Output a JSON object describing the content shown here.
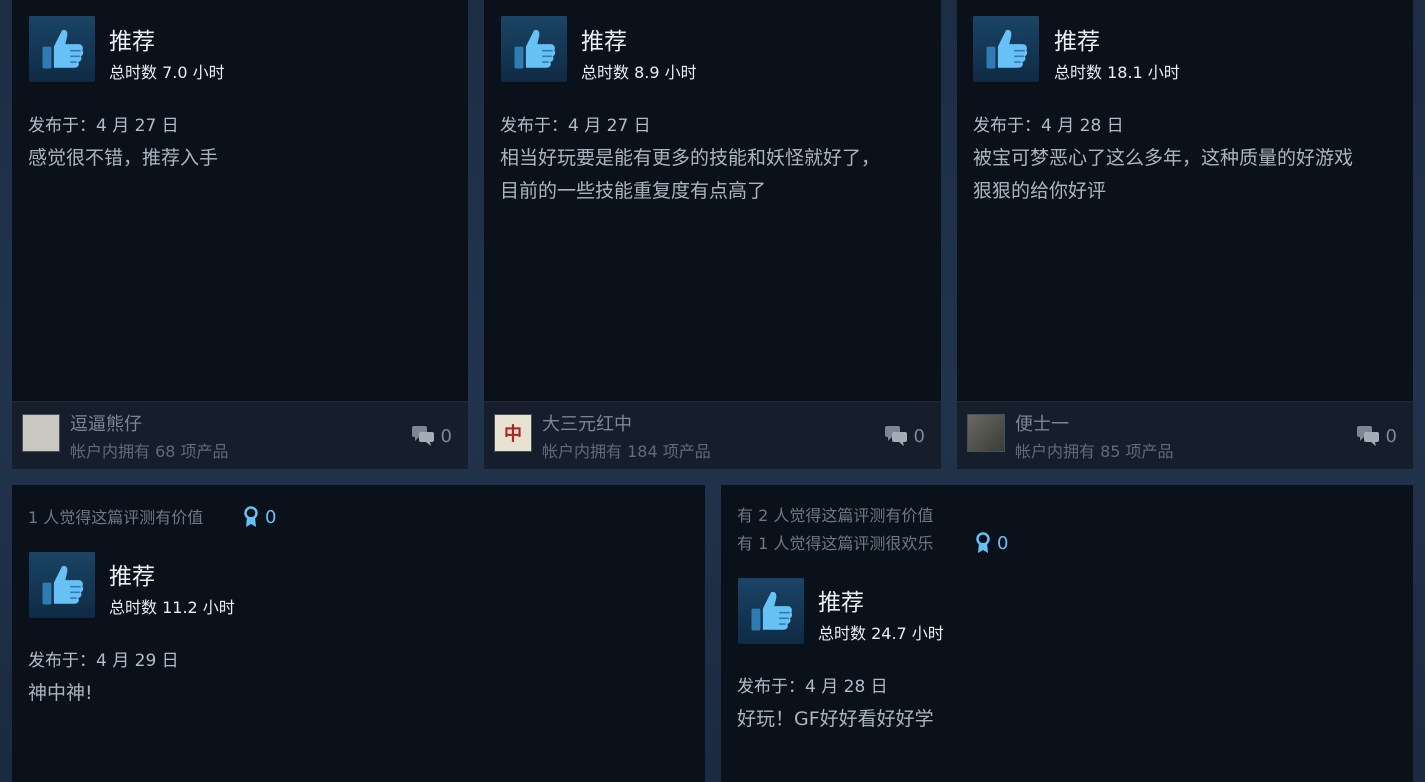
{
  "reviews": [
    {
      "recommend": "推荐",
      "hours": "总时数 7.0 小时",
      "posted": "发布于：4 月 27 日",
      "text": [
        "感觉很不错，推荐入手"
      ],
      "user": "逗逼熊仔",
      "owned": "帐户内拥有 68 项产品",
      "comments": "0"
    },
    {
      "recommend": "推荐",
      "hours": "总时数 8.9 小时",
      "posted": "发布于：4 月 27 日",
      "text": [
        "相当好玩要是能有更多的技能和妖怪就好了，",
        "目前的一些技能重复度有点高了"
      ],
      "user": "大三元红中",
      "owned": "帐户内拥有 184 项产品",
      "comments": "0"
    },
    {
      "recommend": "推荐",
      "hours": "总时数 18.1 小时",
      "posted": "发布于：4 月 28 日",
      "text": [
        "被宝可梦恶心了这么多年，这种质量的好游戏",
        "狠狠的给你好评"
      ],
      "user": "便士一",
      "owned": "帐户内拥有 85 项产品",
      "comments": "0"
    },
    {
      "helpful": [
        "1 人觉得这篇评测有价值"
      ],
      "awards": "0",
      "recommend": "推荐",
      "hours": "总时数 11.2 小时",
      "posted": "发布于：4 月 29 日",
      "text": [
        "神中神!"
      ]
    },
    {
      "helpful": [
        "有 2 人觉得这篇评测有价值",
        "有 1 人觉得这篇评测很欢乐"
      ],
      "awards": "0",
      "recommend": "推荐",
      "hours": "总时数 24.7 小时",
      "posted": "发布于：4 月 28 日",
      "text": [
        "好玩！GF好好看好好学"
      ]
    }
  ],
  "colors": {
    "accent": "#66c0f4",
    "card_bg": "#0b111a",
    "footer_bg": "#151e2a"
  },
  "icons": {
    "recommend": "thumbs-up-icon",
    "comment": "comment-icon",
    "award": "award-icon"
  }
}
